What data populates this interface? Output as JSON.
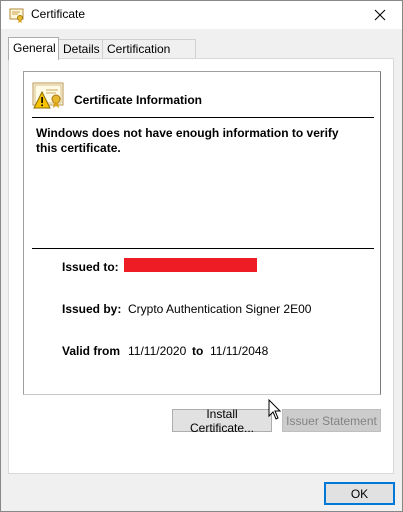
{
  "window": {
    "title": "Certificate"
  },
  "tabs": [
    {
      "label": "General"
    },
    {
      "label": "Details"
    },
    {
      "label": "Certification Path"
    }
  ],
  "info": {
    "heading": "Certificate Information",
    "warning": "Windows does not have enough information to verify this certificate.",
    "issued_to_label": "Issued to:",
    "issued_by_label": "Issued by:",
    "issued_by_value": "Crypto Authentication Signer 2E00",
    "valid_from_label": "Valid from",
    "valid_from_value": "11/11/2020",
    "valid_to_label": "to",
    "valid_to_value": "11/11/2048"
  },
  "buttons": {
    "install_certificate": "Install Certificate...",
    "issuer_statement": "Issuer Statement",
    "ok": "OK"
  },
  "colors": {
    "redaction": "#ee1c25",
    "accent": "#0078d7"
  },
  "icons": [
    "certificate-icon",
    "close-icon",
    "certificate-warning-icon",
    "mouse-cursor-icon"
  ]
}
